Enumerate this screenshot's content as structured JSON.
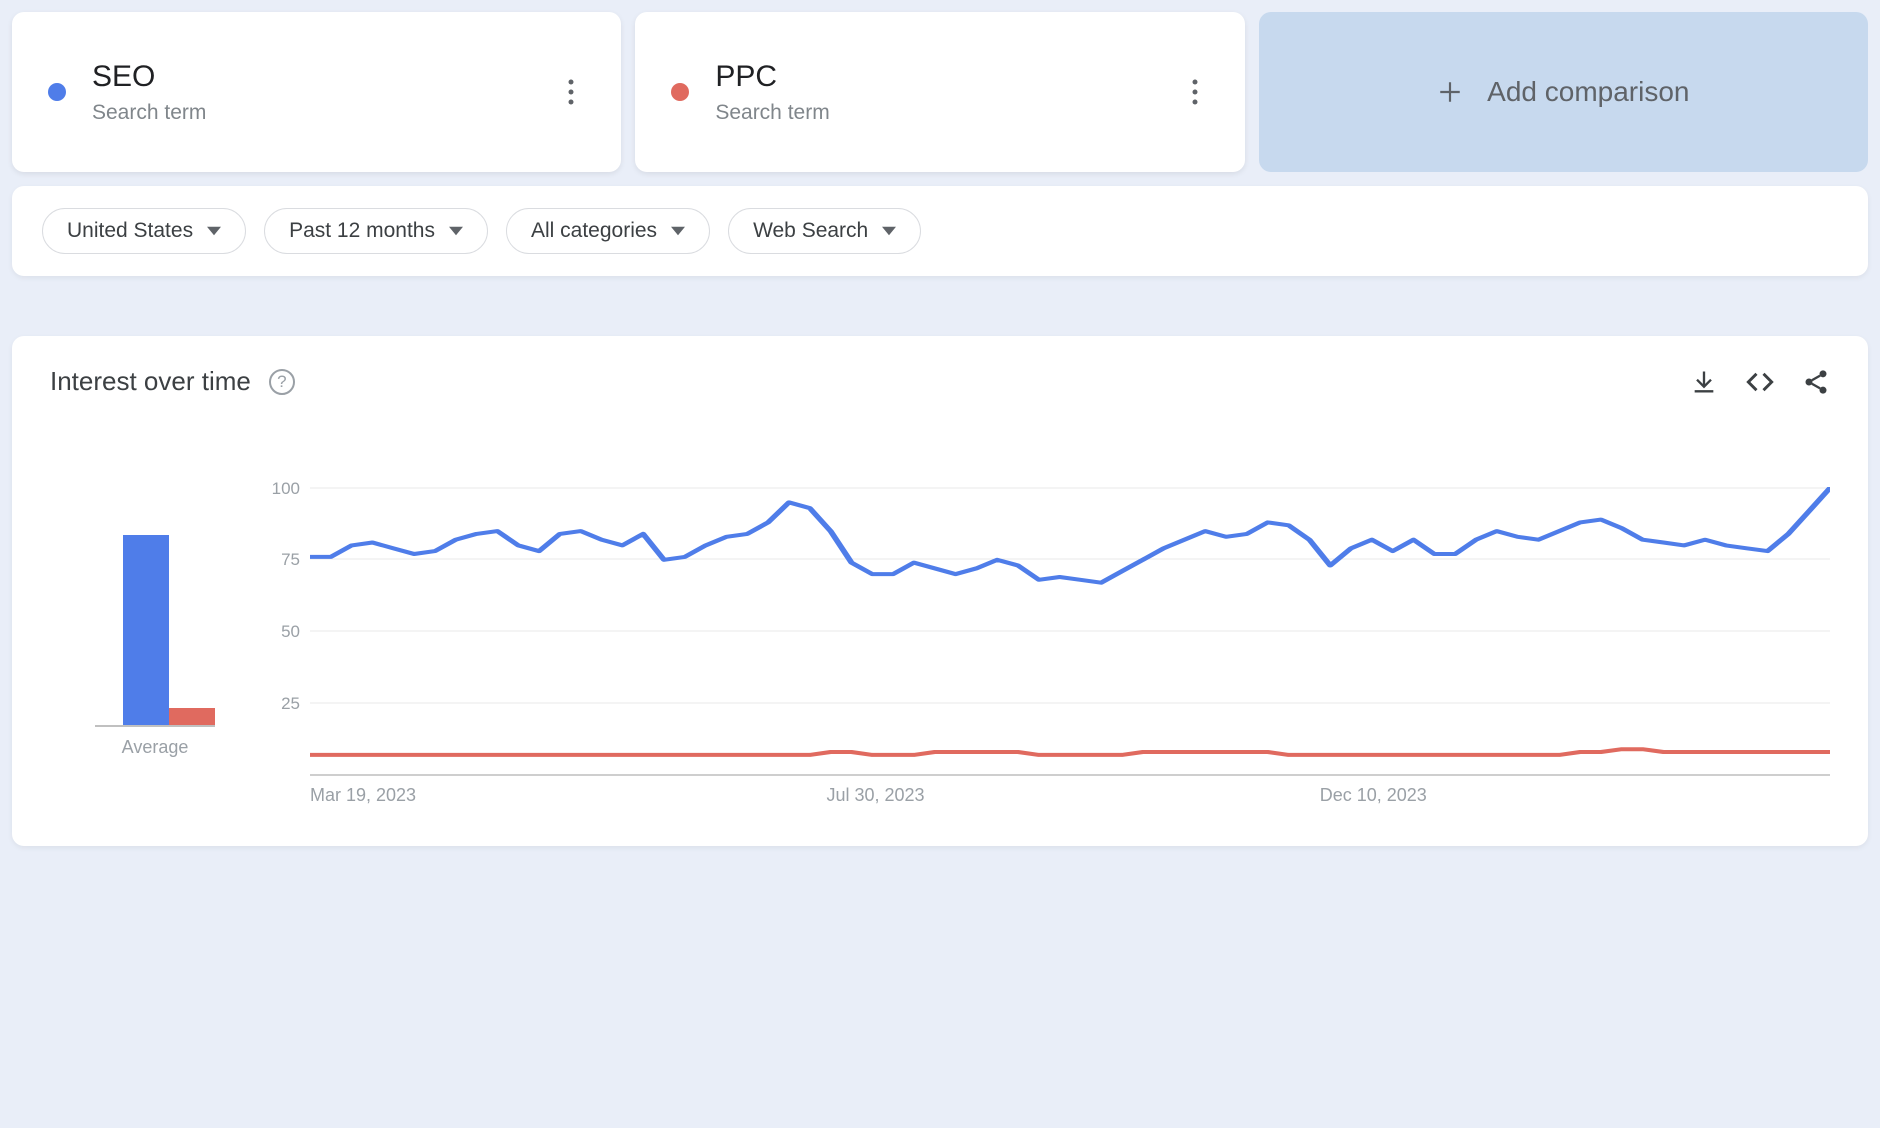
{
  "colors": {
    "series1": "#4f7de9",
    "series2": "#e06a5f"
  },
  "terms": [
    {
      "label": "SEO",
      "sub": "Search term",
      "colorKey": "series1"
    },
    {
      "label": "PPC",
      "sub": "Search term",
      "colorKey": "series2"
    }
  ],
  "add_comparison": {
    "label": "Add comparison"
  },
  "filters": {
    "geo": "United States",
    "time": "Past 12 months",
    "category": "All categories",
    "search_type": "Web Search"
  },
  "chart": {
    "title": "Interest over time",
    "avg_label": "Average",
    "y_ticks": [
      "100",
      "75",
      "50",
      "25"
    ]
  },
  "chart_data": {
    "type": "line",
    "title": "Interest over time",
    "xlabel": "",
    "ylabel": "",
    "ylim": [
      0,
      100
    ],
    "x_tick_labels": [
      "Mar 19, 2023",
      "Jul 30, 2023",
      "Dec 10, 2023"
    ],
    "averages": {
      "SEO": 80,
      "PPC": 7
    },
    "series": [
      {
        "name": "SEO",
        "color": "#4f7de9",
        "values": [
          76,
          76,
          80,
          81,
          79,
          77,
          78,
          82,
          84,
          85,
          80,
          78,
          84,
          85,
          82,
          80,
          84,
          75,
          76,
          80,
          83,
          84,
          88,
          95,
          93,
          85,
          74,
          70,
          70,
          74,
          72,
          70,
          72,
          75,
          73,
          68,
          69,
          68,
          67,
          71,
          75,
          79,
          82,
          85,
          83,
          84,
          88,
          87,
          82,
          73,
          79,
          82,
          78,
          82,
          77,
          77,
          82,
          85,
          83,
          82,
          85,
          88,
          89,
          86,
          82,
          81,
          80,
          82,
          80,
          79,
          78,
          84,
          92,
          100
        ]
      },
      {
        "name": "PPC",
        "color": "#e06a5f",
        "values": [
          7,
          7,
          7,
          7,
          7,
          7,
          7,
          7,
          7,
          7,
          7,
          7,
          7,
          7,
          7,
          7,
          7,
          7,
          7,
          7,
          7,
          7,
          7,
          7,
          7,
          8,
          8,
          7,
          7,
          7,
          8,
          8,
          8,
          8,
          8,
          7,
          7,
          7,
          7,
          7,
          8,
          8,
          8,
          8,
          8,
          8,
          8,
          7,
          7,
          7,
          7,
          7,
          7,
          7,
          7,
          7,
          7,
          7,
          7,
          7,
          7,
          8,
          8,
          9,
          9,
          8,
          8,
          8,
          8,
          8,
          8,
          8,
          8,
          8
        ]
      }
    ]
  }
}
